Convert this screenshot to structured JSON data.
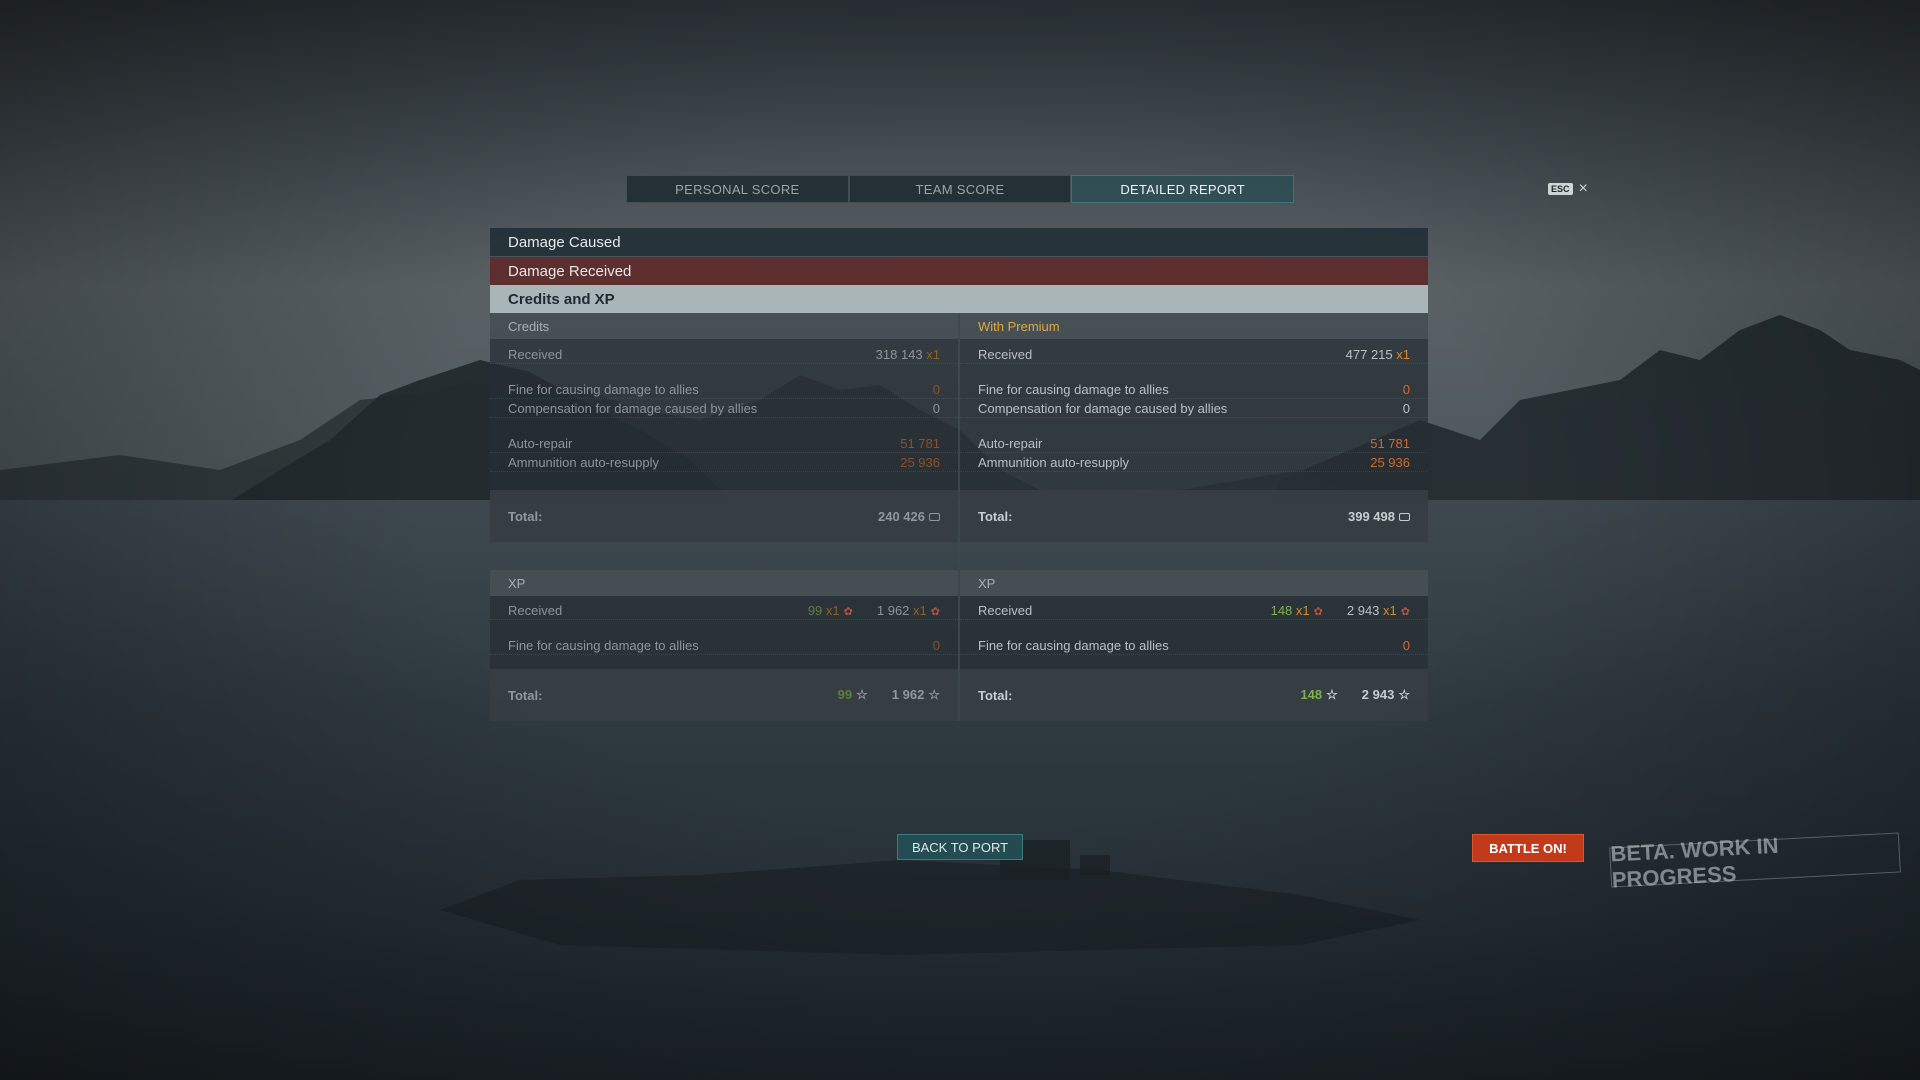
{
  "tabs": [
    {
      "label": "PERSONAL SCORE"
    },
    {
      "label": "TEAM SCORE"
    },
    {
      "label": "DETAILED REPORT"
    }
  ],
  "esc": {
    "key": "ESC",
    "close_glyph": "×"
  },
  "sections": {
    "damage_caused": "Damage Caused",
    "damage_received": "Damage Received",
    "credits_xp": "Credits and XP"
  },
  "credits": {
    "base": {
      "header": "Credits",
      "received_label": "Received",
      "received_value": "318 143",
      "received_mult": "x1",
      "fine_label": "Fine for causing damage to allies",
      "fine_value": "0",
      "comp_label": "Compensation for damage caused by allies",
      "comp_value": "0",
      "repair_label": "Auto-repair",
      "repair_value": "51 781",
      "resupply_label": "Ammunition auto-resupply",
      "resupply_value": "25 936",
      "total_label": "Total:",
      "total_value": "240 426"
    },
    "premium": {
      "header": "With Premium",
      "received_label": "Received",
      "received_value": "477 215",
      "received_mult": "x1",
      "fine_label": "Fine for causing damage to allies",
      "fine_value": "0",
      "comp_label": "Compensation for damage caused by allies",
      "comp_value": "0",
      "repair_label": "Auto-repair",
      "repair_value": "51 781",
      "resupply_label": "Ammunition auto-resupply",
      "resupply_value": "25 936",
      "total_label": "Total:",
      "total_value": "399 498"
    }
  },
  "xp": {
    "base": {
      "header": "XP",
      "received_label": "Received",
      "ship_xp": "99",
      "ship_mult": "x1",
      "free_xp": "1 962",
      "free_mult": "x1",
      "fine_label": "Fine for causing damage to allies",
      "fine_value": "0",
      "total_label": "Total:",
      "total_ship": "99",
      "total_free": "1 962"
    },
    "premium": {
      "header": "XP",
      "received_label": "Received",
      "ship_xp": "148",
      "ship_mult": "x1",
      "free_xp": "2 943",
      "free_mult": "x1",
      "fine_label": "Fine for causing damage to allies",
      "fine_value": "0",
      "total_label": "Total:",
      "total_ship": "148",
      "total_free": "2 943"
    }
  },
  "buttons": {
    "back_to_port": "BACK TO PORT",
    "battle_on": "BATTLE ON!"
  },
  "watermark": "BETA. WORK IN PROGRESS",
  "icons": {
    "star": "☆",
    "wreath": "✿"
  },
  "colors": {
    "premium_header": "#e0a83f",
    "negative": "#d06a2a",
    "xp_green": "#7bb24c",
    "battle_button": "#c23a1a",
    "active_tab": "#2e4e54"
  }
}
